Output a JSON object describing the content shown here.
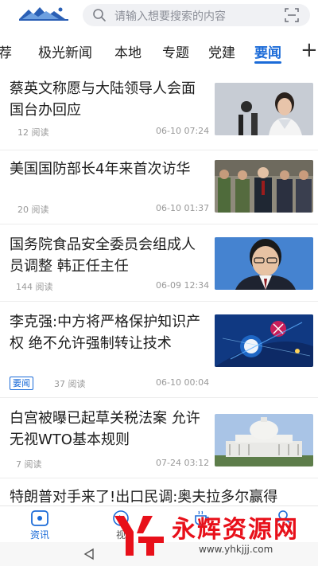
{
  "header": {
    "logo_icon": "aurora-landscape-logo",
    "search_placeholder": "请输入想要搜索的内容",
    "search_icon": "search-icon",
    "scan_icon": "scan-icon"
  },
  "tabs": {
    "items": [
      {
        "label": "推荐",
        "visible": "荐"
      },
      {
        "label": "极光新闻"
      },
      {
        "label": "本地"
      },
      {
        "label": "专题"
      },
      {
        "label": "党建"
      },
      {
        "label": "要闻",
        "active": true
      }
    ],
    "active_color": "#1b6bd8",
    "more_label": "+"
  },
  "news": [
    {
      "title": "蔡英文称愿与大陆领导人会面 国台办回应",
      "reads": "12 阅读",
      "time": "06-10 07:24"
    },
    {
      "title": "美国国防部长4年来首次访华",
      "reads": "20 阅读",
      "time": "06-10 01:37"
    },
    {
      "title": "国务院食品安全委员会组成人员调整 韩正任主任",
      "reads": "144 阅读",
      "time": "06-09 12:34"
    },
    {
      "title": "李克强:中方将严格保护知识产权 绝不允许强制转让技术",
      "badge": "要闻",
      "reads": "37 阅读",
      "time": "06-10 00:04"
    },
    {
      "title": "白宫被曝已起草关税法案 允许无视WTO基本规则",
      "reads": "7 阅读",
      "time": "07-24 03:12"
    },
    {
      "title": "特朗普对手来了!出口民调:奥夫拉多尔赢得"
    }
  ],
  "bottom_nav": {
    "items": [
      {
        "label": "资讯",
        "icon": "news-icon",
        "active": true
      },
      {
        "label": "视频",
        "visible": "视",
        "icon": "play-icon"
      },
      {
        "label": "",
        "icon": "coffee-icon"
      },
      {
        "label": "",
        "icon": "user-icon"
      }
    ],
    "active_color": "#1b6bd8"
  },
  "system_bar": {
    "back_icon": "back-triangle-icon"
  },
  "watermark": {
    "text": "永辉资源网",
    "url": "www.yhkjjj.com"
  }
}
